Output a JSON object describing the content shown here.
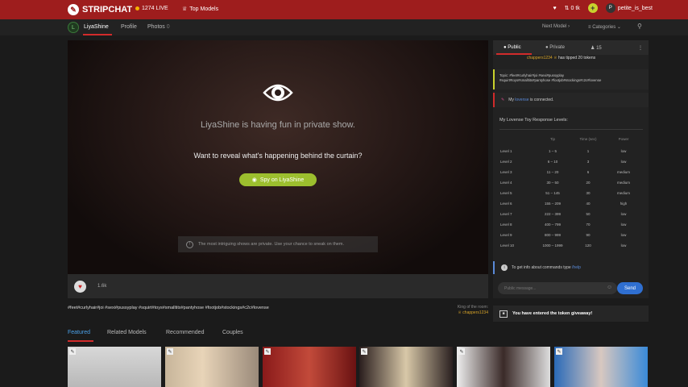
{
  "header": {
    "brand": "STRIPCHAT",
    "live": "1274 LIVE",
    "top_models": "Top Models",
    "tokens": "0 tk",
    "add_tokens": "+",
    "username": "petite_is_best",
    "avatar_initial": "P"
  },
  "model_bar": {
    "avatar_initial": "L",
    "model_name": "LiyaShine",
    "profile": "Profile",
    "photos": "Photos",
    "photos_count": "0",
    "next_model": "Next Model",
    "categories": "Categories"
  },
  "video": {
    "private_text": "LiyaShine is having fun in private show.",
    "reveal_text": "Want to reveal what's happening behind the curtain?",
    "spy_button": "Spy on LiyaShine",
    "intrigue_text": "The most intriguing shows are private. Use your chance to sneak on them."
  },
  "controls": {
    "favorite_count": "1.6k"
  },
  "tags": "#feet#curlyhair#joi #sexi#pussyplay #squirt#toys#smalltits#pantyhose #footjob#stockings#c2c#lovense",
  "king": {
    "label": "King of the room:",
    "name": "chappers1234"
  },
  "chat": {
    "tabs": [
      "Public",
      "Private",
      "15"
    ],
    "tip_user": "chappers1234",
    "tip_text": "has tipped 20 tokens",
    "topic_line1": "Topic: #feet#curlyhair#joi #sexi#pussyplay",
    "topic_line2": "#squirt#toys#smalltits#pantyhose #footjob#stockings#c2c#lovense",
    "lovense_prefix": "My",
    "lovense_link": "lovense",
    "lovense_suffix": "is connected.",
    "levels_title": "My Lovense Toy Response Levels:",
    "levels_headers": [
      "Tip",
      "Time (sec)",
      "Power"
    ],
    "levels": [
      {
        "name": "Level 1",
        "tip": "1 – 5",
        "time": "1",
        "power": "low"
      },
      {
        "name": "Level 2",
        "tip": "6 – 10",
        "time": "3",
        "power": "low"
      },
      {
        "name": "Level 3",
        "tip": "11 – 20",
        "time": "6",
        "power": "medium"
      },
      {
        "name": "Level 4",
        "tip": "30 – 50",
        "time": "20",
        "power": "medium"
      },
      {
        "name": "Level 5",
        "tip": "51 – 145",
        "time": "30",
        "power": "medium"
      },
      {
        "name": "Level 6",
        "tip": "155 – 209",
        "time": "40",
        "power": "high"
      },
      {
        "name": "Level 7",
        "tip": "222 – 399",
        "time": "50",
        "power": "low"
      },
      {
        "name": "Level 8",
        "tip": "400 – 799",
        "time": "70",
        "power": "low"
      },
      {
        "name": "Level 9",
        "tip": "800 – 999",
        "time": "90",
        "power": "low"
      },
      {
        "name": "Level 10",
        "tip": "1000 – 1999",
        "time": "120",
        "power": "low"
      }
    ],
    "commands_text": "To get info about commands type",
    "commands_help": "/help",
    "message_placeholder": "Public message...",
    "send": "Send",
    "giveaway": "You have entered the token giveaway!"
  },
  "feature_tabs": [
    "Featured",
    "Related Models",
    "Recommended",
    "Couples"
  ],
  "colors": {
    "brand_red": "#9e1d1d",
    "accent_green": "#9cbf2e",
    "send_blue": "#2f6fd1"
  }
}
